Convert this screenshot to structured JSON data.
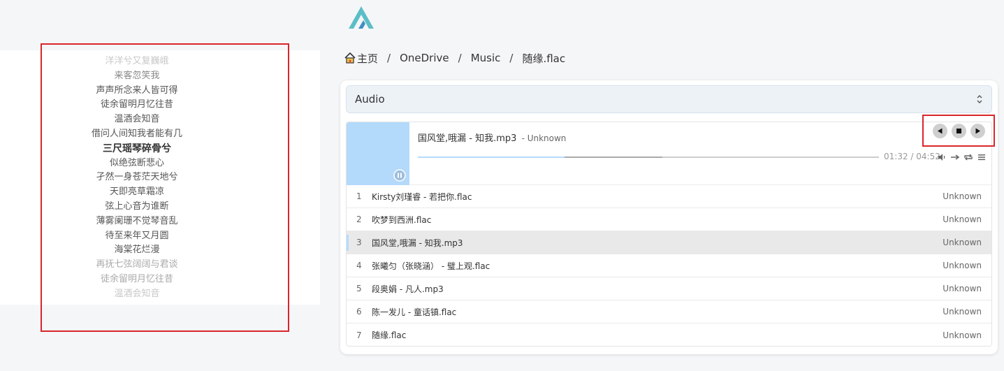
{
  "logo": {
    "icon": "app-logo-icon",
    "color": "#5bbec6"
  },
  "breadcrumb": {
    "home_label": "主页",
    "separator": "/",
    "items": [
      "OneDrive",
      "Music",
      "随缘.flac"
    ]
  },
  "lyrics": {
    "lines": [
      "洋洋兮又复巍峨",
      "来客忽笑我",
      "声声所念来人皆可得",
      "徒余留明月忆往昔",
      "温酒会知音",
      "借问人间知我者能有几",
      "三尺瑶琴碎骨兮",
      "似绝弦断悲心",
      "孑然一身苍茫天地兮",
      "天即亮草霜凉",
      "弦上心音为谁断",
      "薄雾阑珊不觉琴音乱",
      "待至来年又月圆",
      "海棠花烂漫",
      "再抚七弦阔阔与君谈",
      "徒余留明月忆往昔",
      "温酒会知音"
    ],
    "active_index": 6
  },
  "select": {
    "value": "Audio"
  },
  "player": {
    "now_title": "国风堂,哦漏 - 知我.mp3",
    "now_author": "- Unknown",
    "time": "01:32 / 04:52",
    "progress": 0.318,
    "loaded": 0.53,
    "controls": {
      "prev": "◀",
      "stop": "■",
      "next": "▶"
    },
    "accent": "#b7daff"
  },
  "playlist": [
    {
      "index": "1",
      "title": "Kirsty刘瑾睿 - 若把你.flac",
      "author": "Unknown"
    },
    {
      "index": "2",
      "title": "吹梦到西洲.flac",
      "author": "Unknown"
    },
    {
      "index": "3",
      "title": "国风堂,哦漏 - 知我.mp3",
      "author": "Unknown"
    },
    {
      "index": "4",
      "title": "张曦匀（张晓涵） - 璧上观.flac",
      "author": "Unknown"
    },
    {
      "index": "5",
      "title": "段奥娟 - 凡人.mp3",
      "author": "Unknown"
    },
    {
      "index": "6",
      "title": "陈一发儿 - 童话镇.flac",
      "author": "Unknown"
    },
    {
      "index": "7",
      "title": "随缘.flac",
      "author": "Unknown"
    }
  ],
  "current_track_index": 2,
  "highlight_color": "#d9262a"
}
